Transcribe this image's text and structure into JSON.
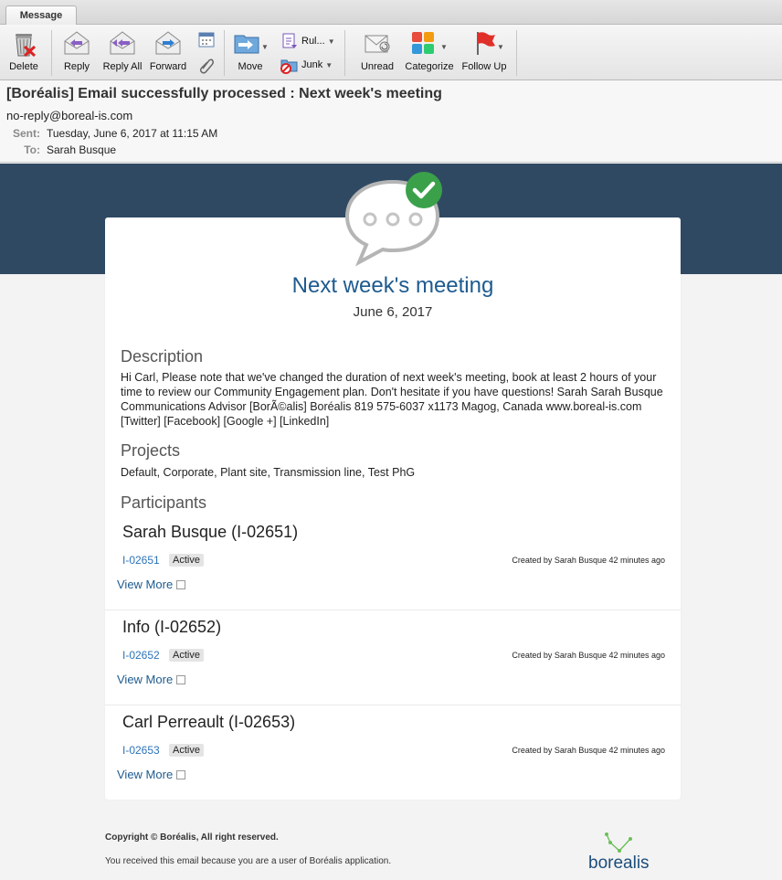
{
  "tabs": [
    "Message"
  ],
  "toolbar": {
    "delete": "Delete",
    "reply": "Reply",
    "reply_all": "Reply All",
    "forward": "Forward",
    "move": "Move",
    "rules": "Rul...",
    "junk": "Junk",
    "unread": "Unread",
    "categorize": "Categorize",
    "follow_up": "Follow Up"
  },
  "message": {
    "subject": "[Boréalis] Email successfully processed : Next week's meeting",
    "from": "no-reply@boreal-is.com",
    "sent_label": "Sent:",
    "sent_value": "Tuesday, June 6, 2017 at 11:15 AM",
    "to_label": "To:",
    "to_value": "Sarah Busque"
  },
  "email": {
    "title": "Next week's meeting",
    "date": "June 6, 2017",
    "description_heading": "Description",
    "description": "Hi Carl, Please note that we've changed the duration of next week's meeting, book at least 2 hours of your time to review our Community Engagement plan. Don't hesitate if you have questions! Sarah Sarah Busque Communications Advisor [BorÃ©alis] Boréalis 819 575-6037 x1173 Magog, Canada www.boreal-is.com [Twitter] [Facebook] [Google +] [LinkedIn]",
    "projects_heading": "Projects",
    "projects": "Default, Corporate, Plant site, Transmission line, Test PhG",
    "participants_heading": "Participants",
    "participants": [
      {
        "name": "Sarah Busque (I-02651)",
        "id": "I-02651",
        "status": "Active",
        "created": "Created by Sarah Busque 42 minutes ago",
        "view_more": "View More"
      },
      {
        "name": "Info (I-02652)",
        "id": "I-02652",
        "status": "Active",
        "created": "Created by Sarah Busque 42 minutes ago",
        "view_more": "View More"
      },
      {
        "name": "Carl Perreault (I-02653)",
        "id": "I-02653",
        "status": "Active",
        "created": "Created by Sarah Busque 42 minutes ago",
        "view_more": "View More"
      }
    ]
  },
  "footer": {
    "copyright": "Copyright © Boréalis, All right reserved.",
    "notice": "You received this email because you are a user of Boréalis application.",
    "logo_text": "borealis"
  },
  "colors": {
    "banner": "#304963",
    "title": "#1d5b8f",
    "link": "#2b73b8",
    "check": "#3aa14a"
  }
}
